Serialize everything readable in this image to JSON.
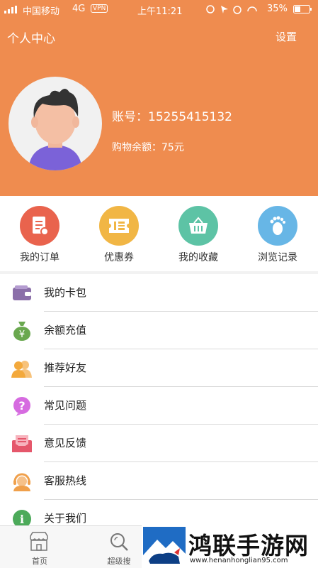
{
  "status_bar": {
    "carrier": "中国移动",
    "network": "4G",
    "vpn": "VPN",
    "time": "上午11:21",
    "battery": "35%"
  },
  "header": {
    "title": "个人中心",
    "settings_label": "设置",
    "account_label": "账号：",
    "account_value": "15255415132",
    "balance_label": "购物余额：",
    "balance_value": "75元"
  },
  "quick_links": [
    {
      "label": "我的订单",
      "color": "#e9634d",
      "icon": "order-icon"
    },
    {
      "label": "优惠券",
      "color": "#f1b645",
      "icon": "coupon-icon"
    },
    {
      "label": "我的收藏",
      "color": "#5dc3a5",
      "icon": "basket-icon"
    },
    {
      "label": "浏览记录",
      "color": "#67b6e6",
      "icon": "footprint-icon"
    }
  ],
  "menu": [
    {
      "label": "我的卡包",
      "icon": "wallet-icon",
      "color": "#8b6fa9"
    },
    {
      "label": "余额充值",
      "icon": "money-bag-icon",
      "color": "#6aa84f"
    },
    {
      "label": "推荐好友",
      "icon": "friends-icon",
      "color": "#f3a93c"
    },
    {
      "label": "常见问题",
      "icon": "question-icon",
      "color": "#d66be0"
    },
    {
      "label": "意见反馈",
      "icon": "feedback-icon",
      "color": "#e5576b"
    },
    {
      "label": "客服热线",
      "icon": "headset-icon",
      "color": "#f0a04b"
    },
    {
      "label": "关于我们",
      "icon": "info-icon",
      "color": "#4caa5a"
    }
  ],
  "tabbar": [
    {
      "label": "首页"
    },
    {
      "label": "超级搜"
    }
  ],
  "watermark": {
    "text": "鸿联手游网",
    "url": "www.henanhonglian95.com"
  },
  "colors": {
    "brand": "#ef8c4f"
  }
}
